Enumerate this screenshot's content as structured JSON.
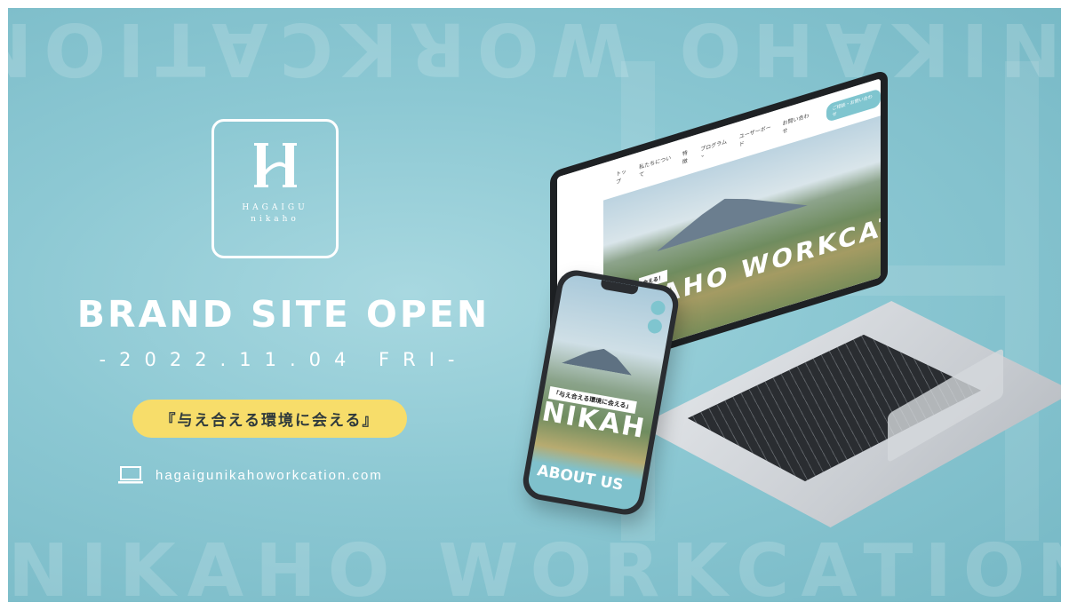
{
  "background": {
    "word_top": "NIKAHO WORKCATION",
    "word_bottom": "NIKAHO WORKCATION",
    "color": "#8cc8d3"
  },
  "logo": {
    "line1": "HAGAIGU",
    "line2": "nikaho"
  },
  "headline": "BRAND SITE OPEN",
  "date": "-2022.11.04 FRI-",
  "tagline": "『与え合える環境に会える』",
  "url": {
    "icon": "laptop-icon",
    "text": "hagaigunikahoworkcation.com"
  },
  "laptop_site": {
    "nav": [
      "トップ",
      "私たちについて",
      "特徴",
      "プログラム ⌄",
      "ユーザーボード",
      "お問い合わせ"
    ],
    "nav_button": "ご相談・お問い合わせ",
    "hero_tag": "会える！",
    "hero_title": "KAHO WORKCATIO"
  },
  "phone_site": {
    "hero_tag": "「与え合える環境に会える」",
    "hero_title": "NIKAH",
    "section": "ABOUT US"
  },
  "accent_color": "#f7dd6a"
}
